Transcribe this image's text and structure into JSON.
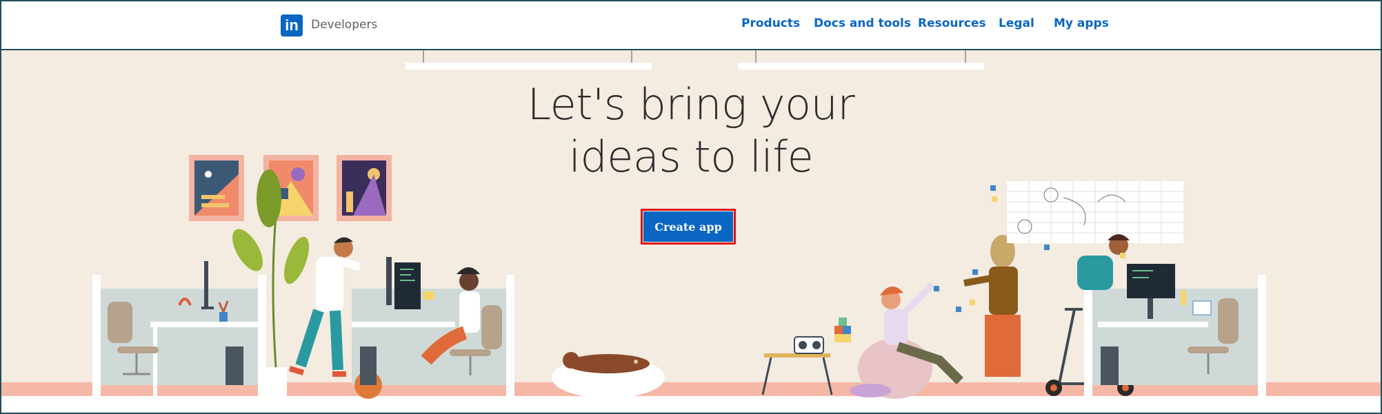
{
  "header": {
    "logo_text": "in",
    "brand": "Developers",
    "nav": [
      {
        "label": "Products"
      },
      {
        "label": "Docs and tools"
      },
      {
        "label": "Resources"
      },
      {
        "label": "Legal"
      },
      {
        "label": "My apps"
      }
    ]
  },
  "hero": {
    "headline_line1": "Let's bring your",
    "headline_line2": "ideas to life",
    "cta_label": "Create app"
  },
  "colors": {
    "brand_blue": "#0a66c2",
    "hero_background": "#f4ebe1",
    "highlight_border": "#e01414",
    "floor_stripe": "#f6b8a6"
  }
}
